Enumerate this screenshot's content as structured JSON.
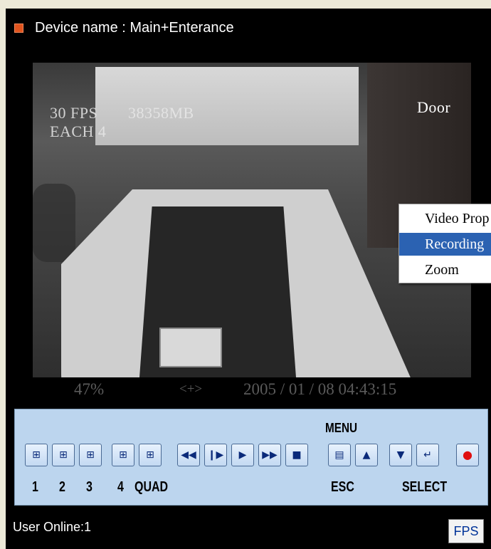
{
  "header": {
    "title": "Device name : Main+Enterance",
    "indicator_color": "#e0541e"
  },
  "video": {
    "overlay_fps": "30 FPS",
    "overlay_storage": "38358MB",
    "overlay_mode": "EACH 4",
    "camera_label": "Door"
  },
  "context_menu": {
    "items": [
      {
        "label": "Video Prop"
      },
      {
        "label": "Recording"
      },
      {
        "label": "Zoom"
      }
    ],
    "selected_index": 1,
    "selected_color": "#2b62b2"
  },
  "status_bar": {
    "percent": "47%",
    "arrows": "<+>",
    "datetime": "2005 / 01 / 08   04:43:15"
  },
  "controls": {
    "menu_label": "MENU",
    "background": "#bcd5ee",
    "buttons": [
      {
        "icon": "split-1-icon"
      },
      {
        "icon": "split-2-icon"
      },
      {
        "icon": "split-3-icon"
      },
      {
        "icon": "split-4-icon"
      },
      {
        "icon": "quad-icon"
      },
      {
        "icon": "rewind-icon"
      },
      {
        "icon": "step-icon"
      },
      {
        "icon": "play-icon"
      },
      {
        "icon": "fast-forward-icon"
      },
      {
        "icon": "stop-icon"
      },
      {
        "icon": "esc-icon"
      },
      {
        "icon": "up-arrow-icon"
      },
      {
        "icon": "down-arrow-icon"
      },
      {
        "icon": "enter-icon"
      },
      {
        "icon": "record-icon"
      }
    ],
    "labels": {
      "one": "1",
      "two": "2",
      "three": "3",
      "four": "4",
      "quad": "QUAD",
      "esc": "ESC",
      "select": "SELECT"
    }
  },
  "footer": {
    "user_online": "User Online:1",
    "fps_button": "FPS"
  }
}
